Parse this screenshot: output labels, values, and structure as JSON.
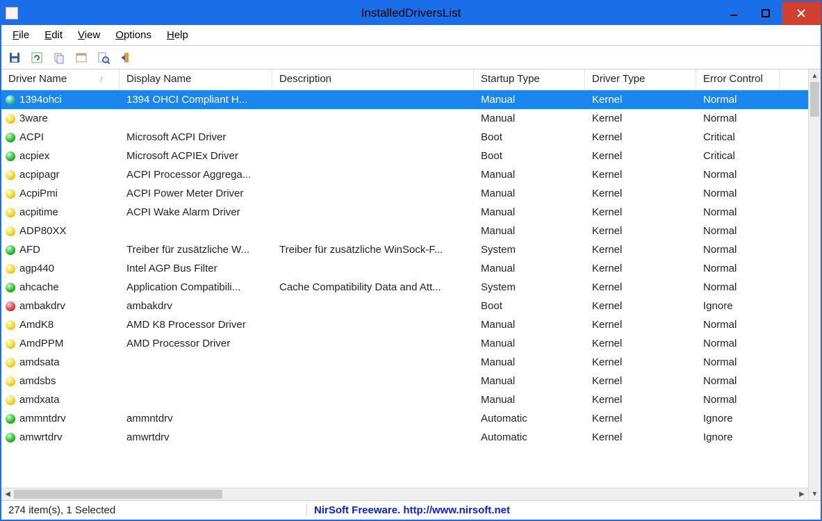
{
  "window": {
    "title": "InstalledDriversList"
  },
  "menu": {
    "file": "File",
    "edit": "Edit",
    "view": "View",
    "options": "Options",
    "help": "Help"
  },
  "toolbar": {
    "save": "save-icon",
    "refresh": "refresh-icon",
    "copy": "copy-icon",
    "properties": "properties-icon",
    "find": "find-icon",
    "exit": "exit-icon"
  },
  "columns": [
    "Driver Name",
    "Display Name",
    "Description",
    "Startup Type",
    "Driver Type",
    "Error Control"
  ],
  "sortGlyph": "/",
  "rows": [
    {
      "status": "teal",
      "name": "1394ohci",
      "display": "1394 OHCI Compliant H...",
      "desc": "",
      "startup": "Manual",
      "type": "Kernel",
      "err": "Normal",
      "selected": true
    },
    {
      "status": "yellow",
      "name": "3ware",
      "display": "",
      "desc": "",
      "startup": "Manual",
      "type": "Kernel",
      "err": "Normal"
    },
    {
      "status": "green",
      "name": "ACPI",
      "display": "Microsoft ACPI Driver",
      "desc": "",
      "startup": "Boot",
      "type": "Kernel",
      "err": "Critical"
    },
    {
      "status": "green",
      "name": "acpiex",
      "display": "Microsoft ACPIEx Driver",
      "desc": "",
      "startup": "Boot",
      "type": "Kernel",
      "err": "Critical"
    },
    {
      "status": "yellow",
      "name": "acpipagr",
      "display": "ACPI Processor Aggrega...",
      "desc": "",
      "startup": "Manual",
      "type": "Kernel",
      "err": "Normal"
    },
    {
      "status": "yellow",
      "name": "AcpiPmi",
      "display": "ACPI Power Meter Driver",
      "desc": "",
      "startup": "Manual",
      "type": "Kernel",
      "err": "Normal"
    },
    {
      "status": "yellow",
      "name": "acpitime",
      "display": "ACPI Wake Alarm Driver",
      "desc": "",
      "startup": "Manual",
      "type": "Kernel",
      "err": "Normal"
    },
    {
      "status": "yellow",
      "name": "ADP80XX",
      "display": "",
      "desc": "",
      "startup": "Manual",
      "type": "Kernel",
      "err": "Normal"
    },
    {
      "status": "green",
      "name": "AFD",
      "display": "Treiber für zusätzliche W...",
      "desc": "Treiber für zusätzliche WinSock-F...",
      "startup": "System",
      "type": "Kernel",
      "err": "Normal"
    },
    {
      "status": "yellow",
      "name": "agp440",
      "display": "Intel AGP Bus Filter",
      "desc": "",
      "startup": "Manual",
      "type": "Kernel",
      "err": "Normal"
    },
    {
      "status": "green",
      "name": "ahcache",
      "display": "Application Compatibili...",
      "desc": "Cache Compatibility Data and Att...",
      "startup": "System",
      "type": "Kernel",
      "err": "Normal"
    },
    {
      "status": "red",
      "name": "ambakdrv",
      "display": "ambakdrv",
      "desc": "",
      "startup": "Boot",
      "type": "Kernel",
      "err": "Ignore"
    },
    {
      "status": "yellow",
      "name": "AmdK8",
      "display": "AMD K8 Processor Driver",
      "desc": "",
      "startup": "Manual",
      "type": "Kernel",
      "err": "Normal"
    },
    {
      "status": "yellow",
      "name": "AmdPPM",
      "display": "AMD Processor Driver",
      "desc": "",
      "startup": "Manual",
      "type": "Kernel",
      "err": "Normal"
    },
    {
      "status": "yellow",
      "name": "amdsata",
      "display": "",
      "desc": "",
      "startup": "Manual",
      "type": "Kernel",
      "err": "Normal"
    },
    {
      "status": "yellow",
      "name": "amdsbs",
      "display": "",
      "desc": "",
      "startup": "Manual",
      "type": "Kernel",
      "err": "Normal"
    },
    {
      "status": "yellow",
      "name": "amdxata",
      "display": "",
      "desc": "",
      "startup": "Manual",
      "type": "Kernel",
      "err": "Normal"
    },
    {
      "status": "green",
      "name": "ammntdrv",
      "display": "ammntdrv",
      "desc": "",
      "startup": "Automatic",
      "type": "Kernel",
      "err": "Ignore"
    },
    {
      "status": "green",
      "name": "amwrtdrv",
      "display": "amwrtdrv",
      "desc": "",
      "startup": "Automatic",
      "type": "Kernel",
      "err": "Ignore"
    }
  ],
  "statusbar": {
    "left": "274 item(s), 1 Selected",
    "right": "NirSoft Freeware.  http://www.nirsoft.net"
  }
}
